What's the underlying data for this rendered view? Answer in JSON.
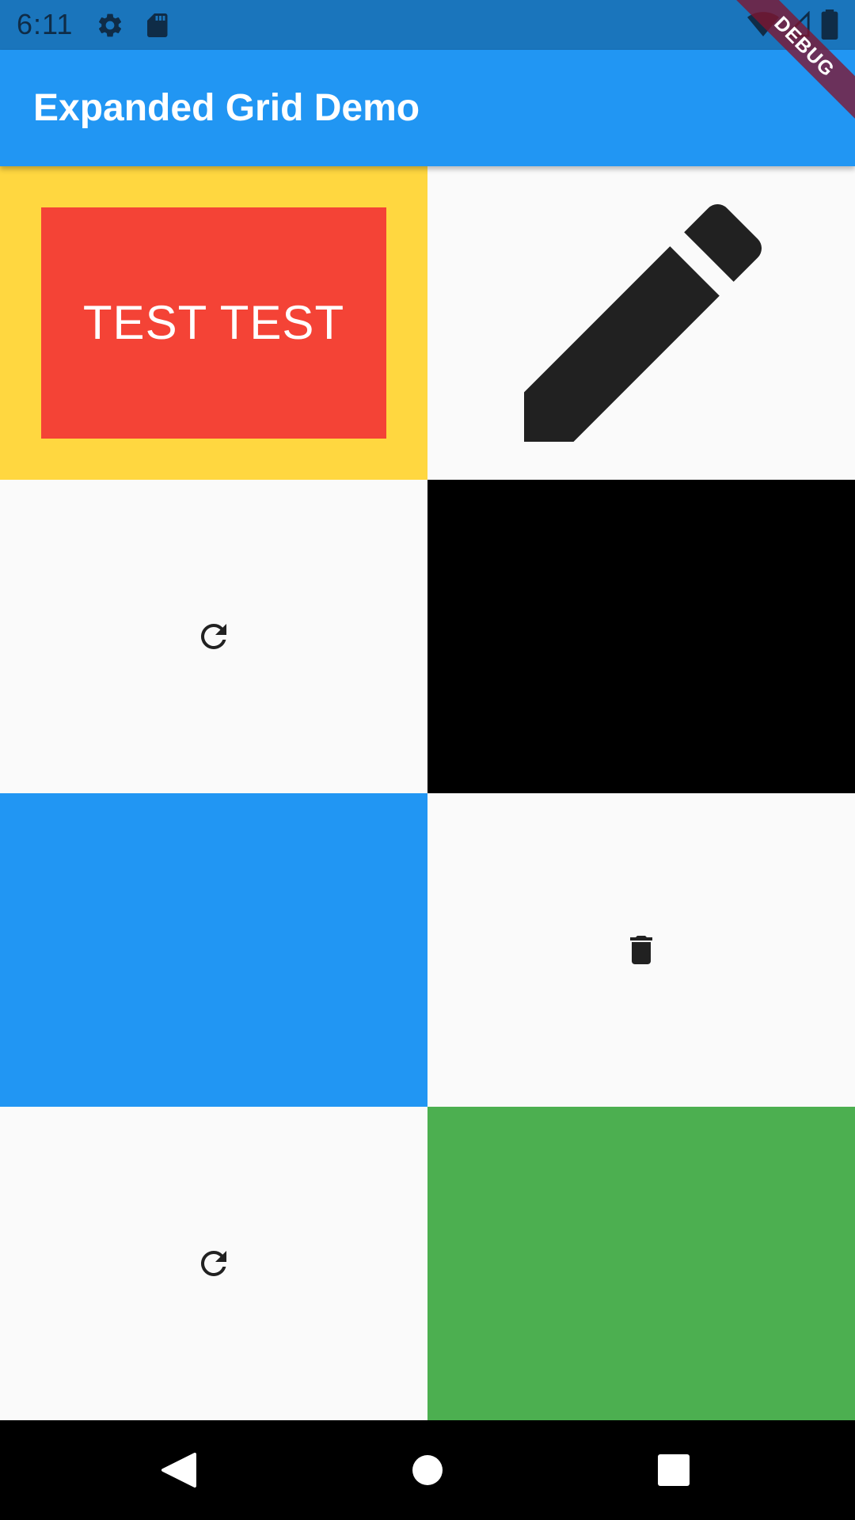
{
  "status_bar": {
    "time": "6:11",
    "icons": [
      "gear-icon",
      "sd-card-icon",
      "wifi-icon",
      "cell-signal-icon",
      "battery-icon"
    ],
    "background": "#1a75bc"
  },
  "app_bar": {
    "title": "Expanded Grid Demo",
    "background": "#2196f3"
  },
  "debug_banner": {
    "label": "DEBUG"
  },
  "grid": {
    "cells": [
      {
        "name": "yellow-cell",
        "color": "#ffd740",
        "content": "red-box"
      },
      {
        "name": "edit-cell",
        "color": "#fafafa",
        "icon": "edit-pencil-icon"
      },
      {
        "name": "refresh-cell-1",
        "color": "#fafafa",
        "icon": "refresh-icon"
      },
      {
        "name": "black-cell",
        "color": "#000000"
      },
      {
        "name": "blue-cell",
        "color": "#2196f3"
      },
      {
        "name": "delete-cell",
        "color": "#fafafa",
        "icon": "delete-icon"
      },
      {
        "name": "refresh-cell-2",
        "color": "#fafafa",
        "icon": "refresh-icon"
      },
      {
        "name": "green-cell",
        "color": "#4caf50"
      }
    ],
    "red_box": {
      "text": "TEST TEST",
      "color": "#f44336"
    }
  },
  "nav_bar": {
    "buttons": [
      "back-icon",
      "home-icon",
      "recents-icon"
    ]
  }
}
